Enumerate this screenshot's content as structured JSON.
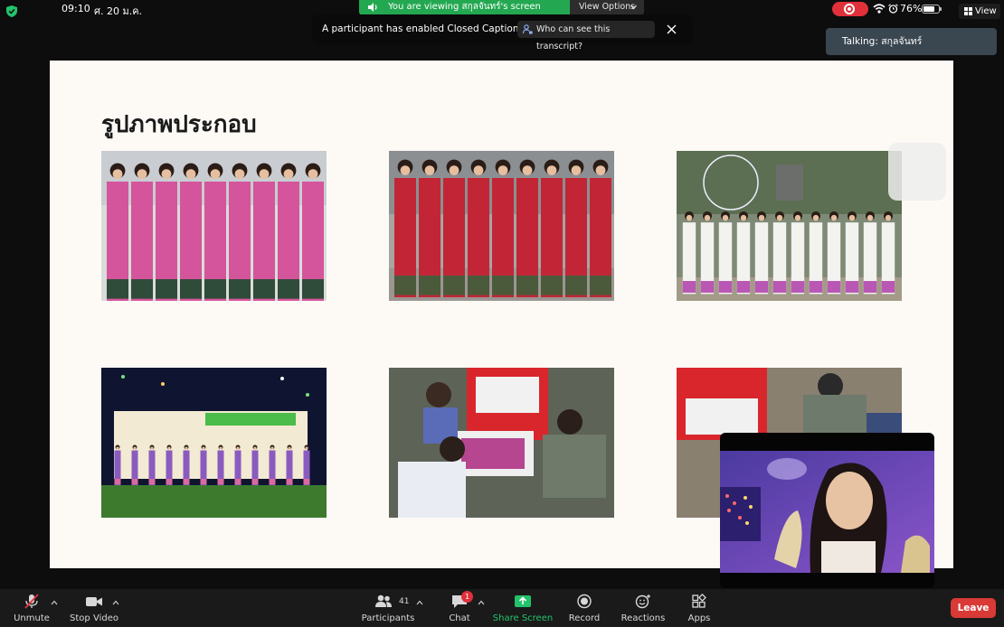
{
  "status_bar": {
    "time": "09:10",
    "date": "ศ. 20 ม.ค.",
    "battery_percent": "76%",
    "battery_level": 0.76
  },
  "share_banner": {
    "viewing_text": "You are viewing สกุลจันทร์'s screen",
    "view_options_label": "View Options"
  },
  "view_button": {
    "label": "View"
  },
  "caption_notice": {
    "message": "A participant has enabled Closed Captioning",
    "who_label": "Who can see this transcript?"
  },
  "talking": {
    "text": "Talking: สกุลจันทร์"
  },
  "slide": {
    "title": "รูปภาพประกอบ",
    "photos": [
      "dancers-pink-costumes",
      "dancers-red-sashes",
      "dancers-white-green-group",
      "stage-group-night",
      "students-flower-boxes",
      "worker-red-cooler"
    ]
  },
  "toolbar": {
    "unmute": "Unmute",
    "stop_video": "Stop Video",
    "participants": "Participants",
    "participants_count": "41",
    "chat": "Chat",
    "chat_badge": "1",
    "share_screen": "Share Screen",
    "record": "Record",
    "reactions": "Reactions",
    "apps": "Apps",
    "leave": "Leave"
  },
  "colors": {
    "share_green": "#23a851",
    "leave_red": "#d93a35",
    "record_red": "#e0303a",
    "talking_bg": "#3a4650"
  }
}
